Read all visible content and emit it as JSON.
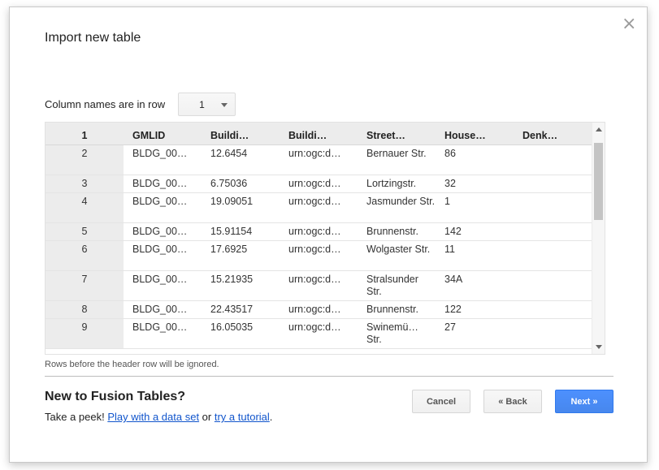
{
  "dialog": {
    "title": "Import new table",
    "close_glyph": "×",
    "column_names_label": "Column names are in row",
    "column_names_row_value": "1",
    "hint": "Rows before the header row will be ignored.",
    "new_title": "New to Fusion Tables?",
    "peek_prefix": "Take a peek! ",
    "peek_link1": "Play with a data set",
    "peek_or": " or ",
    "peek_link2": "try a tutorial",
    "peek_suffix": ".",
    "buttons": {
      "cancel": "Cancel",
      "back": "« Back",
      "next": "Next »"
    }
  },
  "grid": {
    "header": [
      "1",
      "GMLID",
      "Buildi…",
      "Buildi…",
      "Street…",
      "House…",
      "Denk…"
    ],
    "rows": [
      {
        "num": "2",
        "cells": [
          "BLDG_00…",
          "12.6454",
          "urn:ogc:d…",
          "Bernauer Str.",
          "86",
          ""
        ],
        "tall": true
      },
      {
        "num": "3",
        "cells": [
          "BLDG_00…",
          "6.75036",
          "urn:ogc:d…",
          "Lortzingstr.",
          "32",
          ""
        ],
        "tall": false
      },
      {
        "num": "4",
        "cells": [
          "BLDG_00…",
          "19.09051",
          "urn:ogc:d…",
          "Jasmunder Str.",
          "1",
          ""
        ],
        "tall": true
      },
      {
        "num": "5",
        "cells": [
          "BLDG_00…",
          "15.91154",
          "urn:ogc:d…",
          "Brunnenstr.",
          "142",
          ""
        ],
        "tall": false
      },
      {
        "num": "6",
        "cells": [
          "BLDG_00…",
          "17.6925",
          "urn:ogc:d…",
          "Wolgaster Str.",
          "11",
          ""
        ],
        "tall": true
      },
      {
        "num": "7",
        "cells": [
          "BLDG_00…",
          "15.21935",
          "urn:ogc:d…",
          "Stralsunder Str.",
          "34A",
          ""
        ],
        "tall": true
      },
      {
        "num": "8",
        "cells": [
          "BLDG_00…",
          "22.43517",
          "urn:ogc:d…",
          "Brunnenstr.",
          "122",
          ""
        ],
        "tall": false
      },
      {
        "num": "9",
        "cells": [
          "BLDG_00…",
          "16.05035",
          "urn:ogc:d…",
          "Swinemü… Str.",
          "27",
          ""
        ],
        "tall": true
      }
    ]
  }
}
